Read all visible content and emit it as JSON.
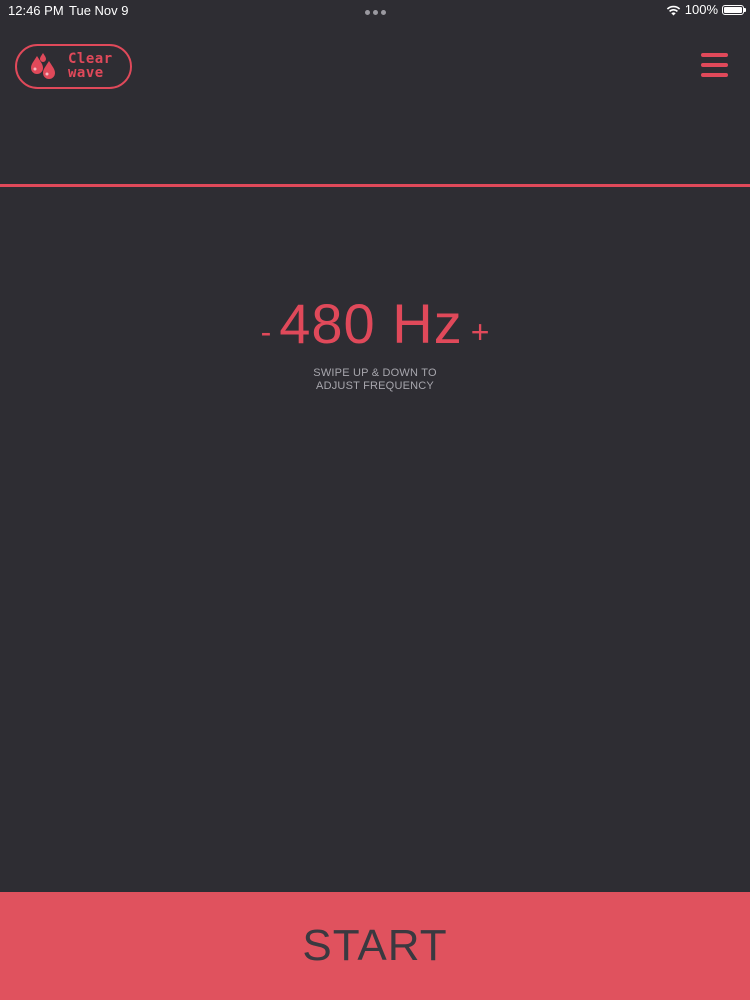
{
  "status_bar": {
    "time": "12:46 PM",
    "date": "Tue Nov 9",
    "battery": "100%",
    "battery_level": 1.0
  },
  "logo": {
    "line1": "Clear",
    "line2": "wave",
    "icon": "droplets-icon"
  },
  "menu": {
    "icon": "hamburger-menu-icon"
  },
  "frequency": {
    "decrease": "-",
    "value": "480 Hz",
    "increase": "+",
    "hint_line1": "SWIPE UP & DOWN TO",
    "hint_line2": "ADJUST FREQUENCY"
  },
  "start": {
    "label": "START"
  },
  "colors": {
    "background": "#2e2d33",
    "accent": "#e0495a",
    "start_bg": "#e0525e",
    "hint": "#a7a6ad"
  }
}
